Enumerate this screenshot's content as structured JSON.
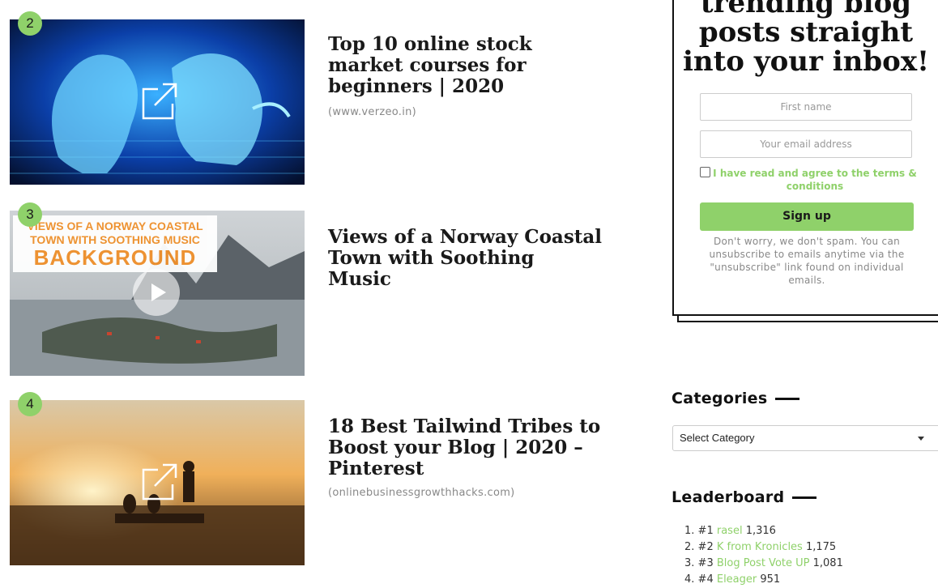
{
  "items": [
    {
      "rank": "2",
      "title": "Top 10 online stock market courses for beginners | 2020",
      "domain": "(www.verzeo.in)",
      "icon": "external-link-icon"
    },
    {
      "rank": "3",
      "title": "Views of a Norway Coastal Town with Soothing Music",
      "domain": "",
      "thumb_text_1": "VIEWS OF A NORWAY COASTAL",
      "thumb_text_2": "TOWN WITH SOOTHING MUSIC",
      "thumb_text_3": "BACKGROUND",
      "icon": "play-icon"
    },
    {
      "rank": "4",
      "title": "18 Best Tailwind Tribes to Boost your Blog | 2020 – Pinterest",
      "domain": "(onlinebusinessgrowthhacks.com)",
      "icon": "external-link-icon"
    }
  ],
  "newsletter": {
    "heading": "trending blog posts straight into your inbox!",
    "first_name_placeholder": "First name",
    "email_placeholder": "Your email address",
    "agree_label": "I have read and agree to the terms & conditions",
    "signup_label": "Sign up",
    "note": "Don't worry, we don't spam. You can unsubscribe to emails anytime via the \"unsubscribe\" link found on individual emails."
  },
  "categories": {
    "title": "Categories",
    "selected": "Select Category"
  },
  "leaderboard": {
    "title": "Leaderboard",
    "entries": [
      {
        "num": "1.",
        "rank": "#1",
        "name": "rasel",
        "score": "1,316"
      },
      {
        "num": "2.",
        "rank": "#2",
        "name": "K from Kronicles",
        "score": "1,175"
      },
      {
        "num": "3.",
        "rank": "#3",
        "name": "Blog Post Vote UP",
        "score": "1,081"
      },
      {
        "num": "4.",
        "rank": "#4",
        "name": "Eleager",
        "score": "951"
      }
    ]
  },
  "colors": {
    "accent": "#8fd16a",
    "text": "#1a1a1a",
    "muted": "#888888"
  }
}
